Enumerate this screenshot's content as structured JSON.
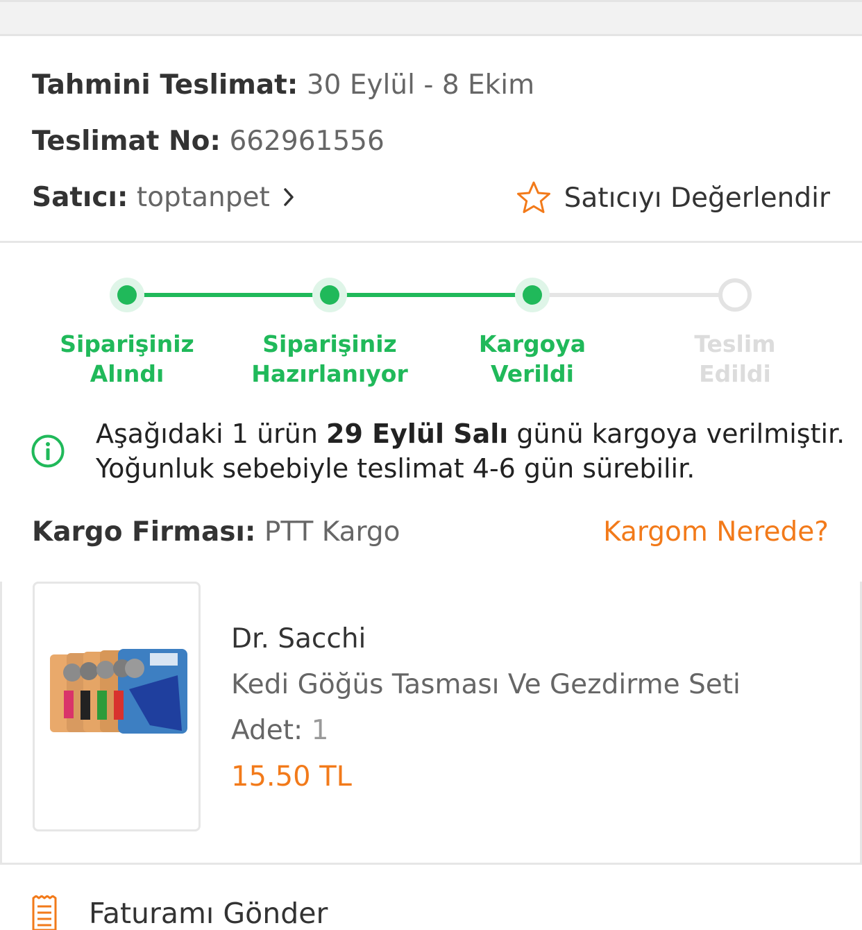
{
  "delivery": {
    "estimate_label": "Tahmini Teslimat:",
    "estimate_value": "30 Eylül - 8 Ekim",
    "number_label": "Teslimat No:",
    "number_value": "662961556",
    "seller_label": "Satıcı:",
    "seller_value": "toptanpet",
    "rate_seller": "Satıcıyı Değerlendir"
  },
  "tracker": {
    "steps": [
      {
        "line1": "Siparişiniz",
        "line2": "Alındı",
        "done": true
      },
      {
        "line1": "Siparişiniz",
        "line2": "Hazırlanıyor",
        "done": true
      },
      {
        "line1": "Kargoya",
        "line2": "Verildi",
        "done": true
      },
      {
        "line1": "Teslim",
        "line2": "Edildi",
        "done": false
      }
    ]
  },
  "notice": {
    "part1": "Aşağıdaki 1 ürün ",
    "bold": "29 Eylül Salı",
    "part2": " günü kargoya verilmiştir.",
    "line2": "Yoğunluk sebebiyle teslimat 4-6 gün sürebilir."
  },
  "cargo": {
    "label": "Kargo Firması:",
    "value": "PTT Kargo",
    "track_link": "Kargom Nerede?"
  },
  "product": {
    "brand": "Dr. Sacchi",
    "name": "Kedi Göğüs Tasması Ve Gezdirme Seti",
    "qty_label": "Adet:",
    "qty_value": "1",
    "price": "15.50 TL"
  },
  "invoice": {
    "label": "Faturamı Gönder"
  },
  "colors": {
    "accent": "#f27a1a",
    "success": "#20b95a",
    "inactive": "#dcdcdc"
  }
}
